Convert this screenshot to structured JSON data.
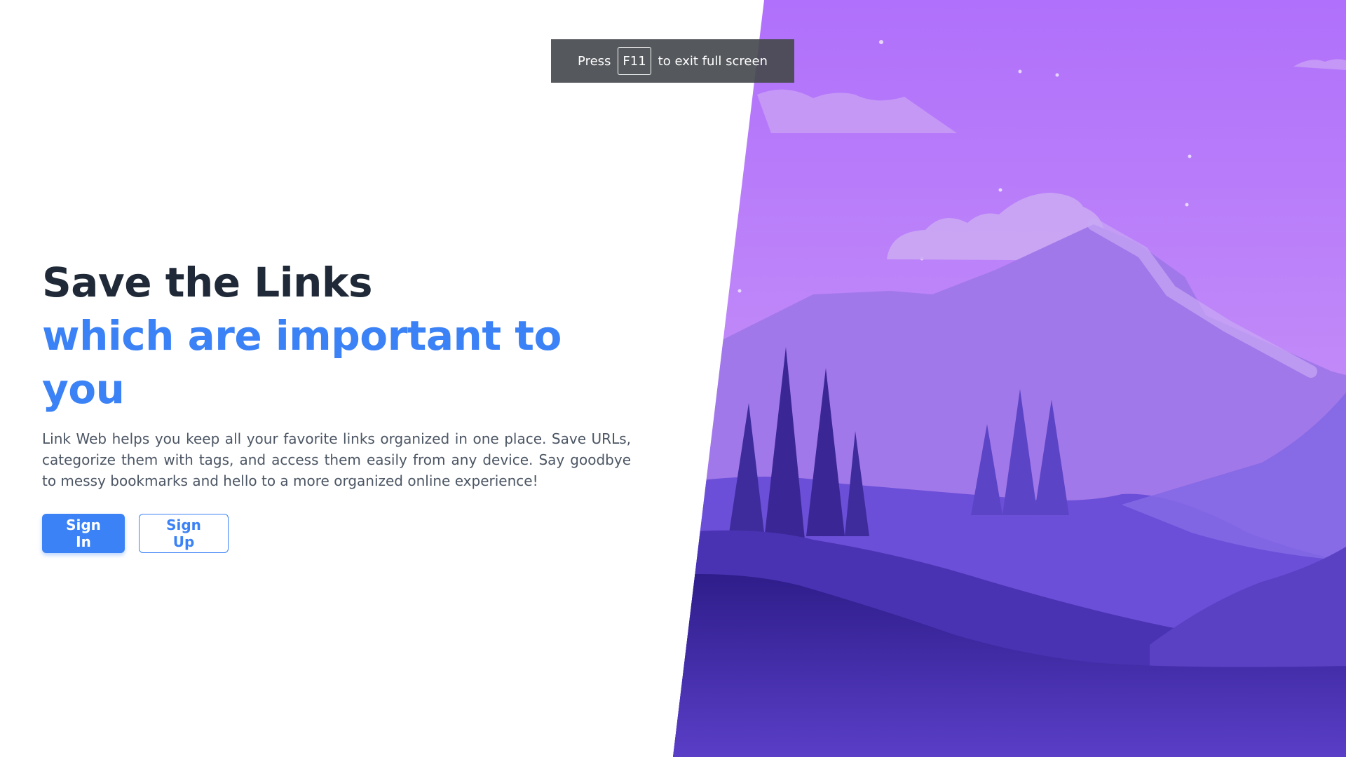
{
  "hero": {
    "title_line1": "Save the Links",
    "title_line2": "which are important to you",
    "description": "Link Web helps you keep all your favorite links organized in one place. Save URLs, categorize them with tags, and access them easily from any device. Say goodbye to messy bookmarks and hello to a more organized online experience!",
    "signin_label": "Sign In",
    "signup_label": "Sign Up",
    "illustration": "night-mountain-landscape"
  },
  "fullscreen_toast": {
    "prefix": "Press",
    "key": "F11",
    "suffix": "to exit full screen"
  },
  "colors": {
    "heading": "#1f2937",
    "accent": "#3b82f6",
    "body_text": "#4b5563",
    "sky_top": "#b070fb",
    "sky_bottom": "#c695f6",
    "mountain_dark": "#3b2696"
  }
}
